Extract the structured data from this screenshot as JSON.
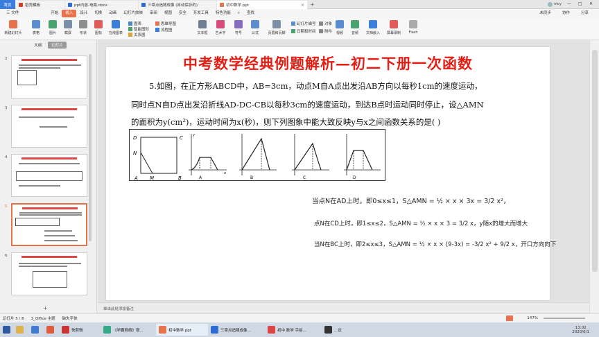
{
  "titlebar": {
    "home": "首页",
    "tabs": [
      {
        "label": "稻壳模板",
        "color": "#d93b2b"
      },
      {
        "label": "ppt内容-电瓶.docx",
        "color": "#2e6bd6"
      },
      {
        "label": "三章点追随成像 (自动保存的)",
        "color": "#2e6bd6"
      },
      {
        "label": "初中数学.ppt",
        "color": "#e8734a"
      }
    ],
    "user": "vicy",
    "win_min": "—",
    "win_max": "□",
    "win_close": "✕"
  },
  "menubar": {
    "file": "三 文件",
    "items": [
      "开始",
      "插入",
      "设计",
      "切换",
      "动画",
      "幻灯片放映",
      "审阅",
      "视图",
      "安全",
      "开发工具",
      "特色功能"
    ],
    "active_index": 1,
    "search": "查找",
    "right": [
      "未同步",
      "协作",
      "分享"
    ]
  },
  "ribbon": {
    "new_slide": "新建幻灯片",
    "table": "表格",
    "image": "图片",
    "screenshot": "截屏",
    "shape": "形状",
    "icon": "图标",
    "online_chart": "在线图表",
    "chart": "图表",
    "smartart": "智能图形",
    "mindmap": "思维导图",
    "flowchart": "流程图",
    "mindtree": "关系图",
    "textbox": "文本框",
    "wordart": "艺术字",
    "symbol": "符号",
    "formula": "公式",
    "header_footer": "页眉和页脚",
    "datetime": "日期和时间",
    "slide_number": "幻灯片编号",
    "object": "对象",
    "attachment": "附件",
    "video": "视频",
    "audio": "音频",
    "docs_embed": "文档嵌入",
    "screen_record": "屏幕录制",
    "flash": "Flash"
  },
  "leftpane": {
    "tabs": [
      "大纲",
      "幻灯片"
    ],
    "thumbs": [
      "2",
      "3",
      "4",
      "5",
      "6"
    ],
    "selected": "5"
  },
  "slide": {
    "title": "中考数学经典例题解析—初二下册一次函数",
    "problem_lines": [
      "5.如图，在正方形ABCD中，AB=3cm，动点M自A点出发沿AB方向以每秒1cm的速度运动，",
      "同时点N自D点出发沿折线AD-DC-CB以每秒3cm的速度运动，到达B点时运动同时停止，设△AMN",
      "的面积为y(cm²)，运动时间为x(秒)，则下列图象中能大致反映y与x之间函数关系的是(    )"
    ],
    "square_labels": [
      "D",
      "C",
      "N",
      "A",
      "M",
      "B"
    ],
    "graph_labels": [
      "A",
      "B",
      "C",
      "D"
    ],
    "axis_y": "y",
    "axis_x": "x",
    "axis_o": "O",
    "ticks": [
      "1",
      "2",
      "3"
    ],
    "solutions": [
      "当点N在AD上时，即0≤x≤1，S△AMN = ½ × x × 3x = 3/2 x²，",
      "点N在CD上时，即1≤x≤2，S△AMN = ½ × x × 3 = 3/2 x，y随x的增大而增大",
      "当N在BC上时，即2≤x≤3，S△AMN = ½ × x × (9-3x) = -3/2 x² + 9/2 x，开口方向向下"
    ]
  },
  "notes": "单击此处添加备注",
  "statusbar": {
    "slide_info": "幻灯片 5 / 8",
    "theme": "3_Office 主题",
    "font_missing": "缺失字体",
    "zoom": "147%"
  },
  "taskbar": {
    "items": [
      "快剪辑",
      "《学霸网络》夜...",
      "初中数学.ppt",
      "三章点追随成像...",
      "初中 数学 手绘...",
      "...议"
    ],
    "time": "13:02",
    "date": "2020/6/1"
  }
}
